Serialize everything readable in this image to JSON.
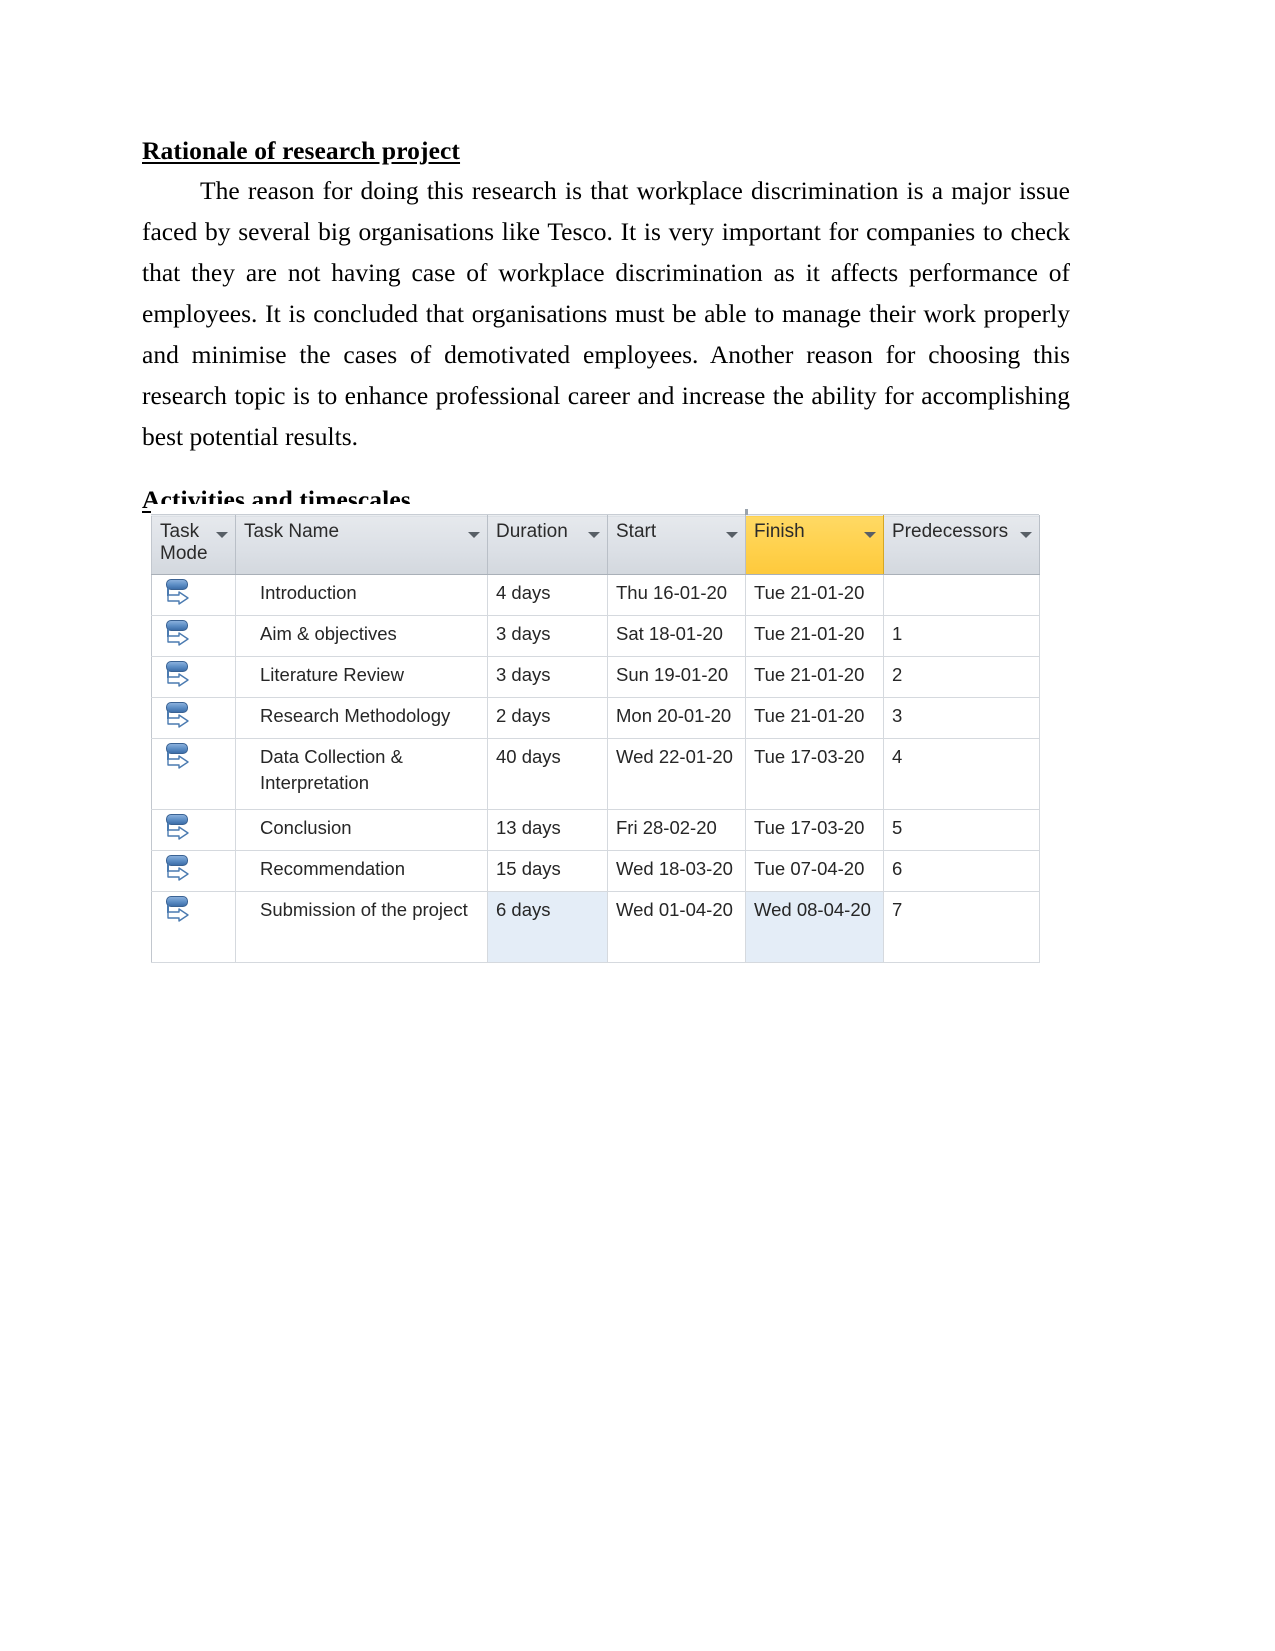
{
  "document": {
    "heading_1": "Rationale of research project",
    "paragraph_1": "The reason for doing this research is that workplace discrimination is a major issue faced by several big organisations like Tesco. It is very important for companies to check that they are not having case of workplace discrimination as it affects performance of employees. It is concluded that organisations must be able to manage their work properly and minimise the cases of demotivated employees. Another reason for choosing this research topic is to enhance professional career and increase the ability for  accomplishing best potential results.",
    "heading_2": "Activities and timescales"
  },
  "project_table": {
    "highlight_color": "#ffd04a",
    "selection_color": "#e4edf7",
    "columns": [
      {
        "key": "task_mode",
        "label": "Task Mode",
        "has_filter": true
      },
      {
        "key": "task_name",
        "label": "Task Name",
        "has_filter": true
      },
      {
        "key": "duration",
        "label": "Duration",
        "has_filter": true
      },
      {
        "key": "start",
        "label": "Start",
        "has_filter": true
      },
      {
        "key": "finish",
        "label": "Finish",
        "has_filter": true,
        "highlighted": true
      },
      {
        "key": "predecessors",
        "label": "Predecessors",
        "has_filter": true
      }
    ],
    "rows": [
      {
        "mode_icon": "manually-scheduled-task-icon",
        "task_name": "Introduction",
        "duration": "4 days",
        "start": "Thu 16-01-20",
        "finish": "Tue 21-01-20",
        "predecessors": ""
      },
      {
        "mode_icon": "manually-scheduled-task-icon",
        "task_name": "Aim & objectives",
        "duration": "3 days",
        "start": "Sat 18-01-20",
        "finish": "Tue 21-01-20",
        "predecessors": "1"
      },
      {
        "mode_icon": "manually-scheduled-task-icon",
        "task_name": "Literature Review",
        "duration": "3 days",
        "start": "Sun 19-01-20",
        "finish": "Tue 21-01-20",
        "predecessors": "2"
      },
      {
        "mode_icon": "manually-scheduled-task-icon",
        "task_name": "Research Methodology",
        "duration": "2 days",
        "start": "Mon 20-01-20",
        "finish": "Tue 21-01-20",
        "predecessors": "3"
      },
      {
        "mode_icon": "manually-scheduled-task-icon",
        "task_name": "Data Collection & Interpretation",
        "duration": "40 days",
        "start": "Wed 22-01-20",
        "finish": "Tue 17-03-20",
        "predecessors": "4"
      },
      {
        "mode_icon": "manually-scheduled-task-icon",
        "task_name": "Conclusion",
        "duration": "13 days",
        "start": "Fri 28-02-20",
        "finish": "Tue 17-03-20",
        "predecessors": "5"
      },
      {
        "mode_icon": "manually-scheduled-task-icon",
        "task_name": "Recommendation",
        "duration": "15 days",
        "start": "Wed 18-03-20",
        "finish": "Tue 07-04-20",
        "predecessors": "6"
      },
      {
        "mode_icon": "manually-scheduled-task-icon",
        "task_name": "Submission of the project",
        "duration": "6 days",
        "start": "Wed 01-04-20",
        "finish": "Wed 08-04-20",
        "predecessors": "7"
      }
    ]
  }
}
